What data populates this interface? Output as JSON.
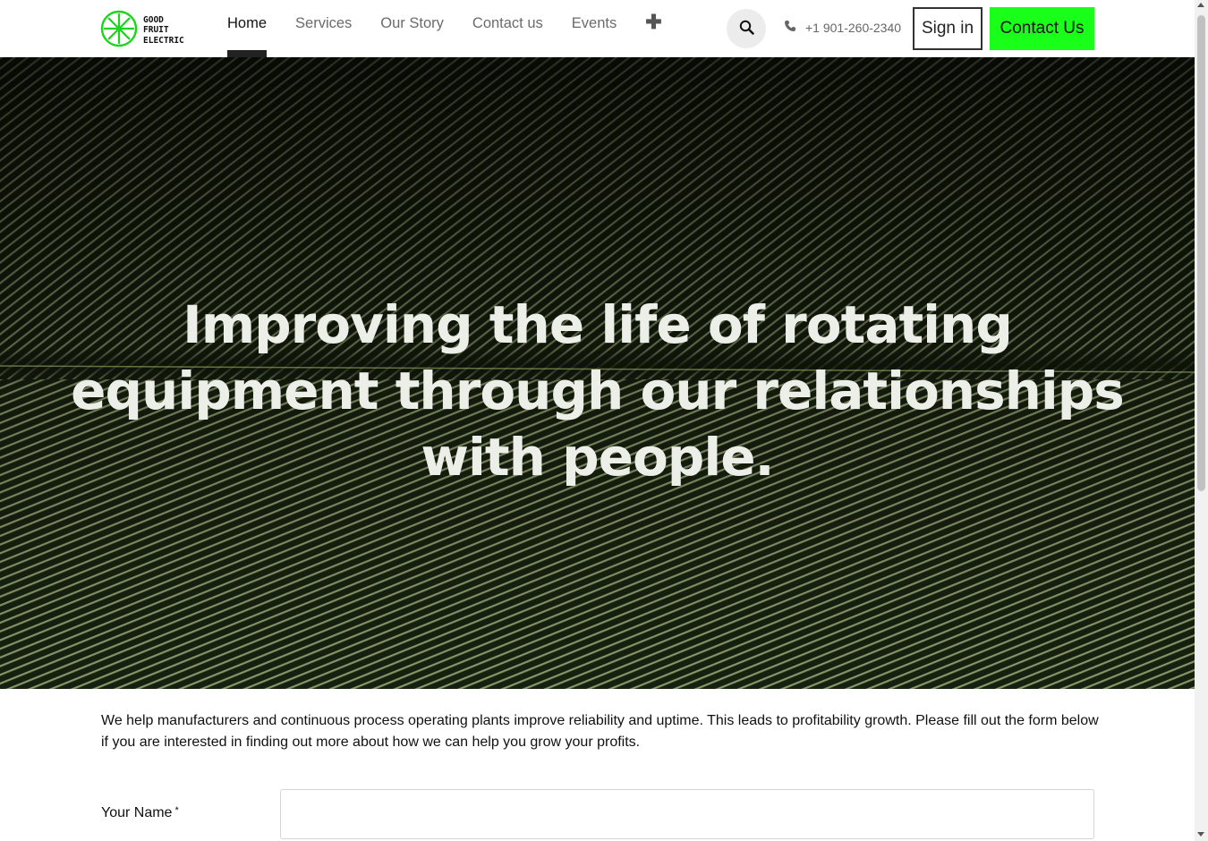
{
  "brand": {
    "logo_lines": [
      "GOOD",
      "FRUIT",
      "ELECTRIC"
    ],
    "logo_icon": "citrus-slice-icon",
    "accent_color": "#19ff19"
  },
  "nav": {
    "items": [
      {
        "label": "Home",
        "active": true
      },
      {
        "label": "Services",
        "active": false
      },
      {
        "label": "Our Story",
        "active": false
      },
      {
        "label": "Contact us",
        "active": false
      },
      {
        "label": "Events",
        "active": false
      }
    ],
    "more_icon": "plus-icon"
  },
  "header": {
    "search_icon": "search-icon",
    "phone_icon": "phone-icon",
    "phone": "+1 901-260-2340",
    "signin_label": "Sign in",
    "contact_label": "Contact Us"
  },
  "hero": {
    "title_lines": [
      "Improving the life of rotating",
      "equipment through our relationships",
      "with people."
    ]
  },
  "intro": {
    "text": "We help manufacturers and continuous process operating plants improve reliability and uptime.  This leads to profitability growth.  Please fill out the form below if you are interested in finding out more about how we can help you grow your profits."
  },
  "form": {
    "name_label": "Your Name",
    "required_mark": "*",
    "name_value": ""
  }
}
